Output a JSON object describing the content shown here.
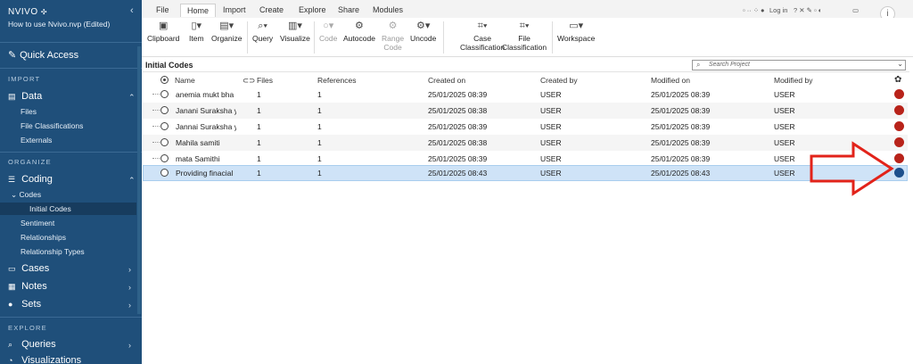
{
  "sidebar": {
    "logo": "NVIVO",
    "project_name": "How to use Nvivo.nvp (Edited)",
    "quick_access": "Quick Access",
    "import_section": "IMPORT",
    "data": "Data",
    "data_items": [
      "Files",
      "File Classifications",
      "Externals"
    ],
    "organize_section": "ORGANIZE",
    "coding": "Coding",
    "codes": "Codes",
    "initial_codes": "Initial Codes",
    "coding_items": [
      "Sentiment",
      "Relationships",
      "Relationship Types"
    ],
    "cases": "Cases",
    "notes": "Notes",
    "sets": "Sets",
    "explore_section": "EXPLORE",
    "queries": "Queries",
    "visualizations": "Visualizations"
  },
  "tabs": [
    "File",
    "Home",
    "Import",
    "Create",
    "Explore",
    "Share",
    "Modules"
  ],
  "active_tab": "Home",
  "login": "Log in",
  "ribbon": {
    "clipboard": "Clipboard",
    "item": "Item",
    "organize": "Organize",
    "query": "Query",
    "visualize": "Visualize",
    "code": "Code",
    "autocode": "Autocode",
    "range_code_1": "Range",
    "range_code_2": "Code",
    "uncode": "Uncode",
    "case_class_1": "Case",
    "case_class_2": "Classification",
    "file_class_1": "File",
    "file_class_2": "Classification",
    "workspace": "Workspace"
  },
  "panel_title": "Initial Codes",
  "search_placeholder": "Search Project",
  "columns": {
    "name": "Name",
    "files": "Files",
    "references": "References",
    "created_on": "Created on",
    "created_by": "Created by",
    "modified_on": "Modified on",
    "modified_by": "Modified by"
  },
  "rows": [
    {
      "name": "anemia mukt bha",
      "files": "1",
      "references": "1",
      "created_on": "25/01/2025 08:39",
      "created_by": "USER",
      "modified_on": "25/01/2025 08:39",
      "modified_by": "USER",
      "color": "#b8231a"
    },
    {
      "name": "Janani Suraksha y",
      "files": "1",
      "references": "1",
      "created_on": "25/01/2025 08:38",
      "created_by": "USER",
      "modified_on": "25/01/2025 08:39",
      "modified_by": "USER",
      "color": "#b8231a"
    },
    {
      "name": "Jannai Suraksha y",
      "files": "1",
      "references": "1",
      "created_on": "25/01/2025 08:39",
      "created_by": "USER",
      "modified_on": "25/01/2025 08:39",
      "modified_by": "USER",
      "color": "#b8231a"
    },
    {
      "name": "Mahila samiti",
      "files": "1",
      "references": "1",
      "created_on": "25/01/2025 08:38",
      "created_by": "USER",
      "modified_on": "25/01/2025 08:39",
      "modified_by": "USER",
      "color": "#b8231a"
    },
    {
      "name": "mata Samithi",
      "files": "1",
      "references": "1",
      "created_on": "25/01/2025 08:39",
      "created_by": "USER",
      "modified_on": "25/01/2025 08:39",
      "modified_by": "USER",
      "color": "#b8231a"
    },
    {
      "name": "Providing  finacial",
      "files": "1",
      "references": "1",
      "created_on": "25/01/2025 08:43",
      "created_by": "USER",
      "modified_on": "25/01/2025 08:43",
      "modified_by": "USER",
      "color": "#1c4f8c"
    }
  ],
  "colors": {
    "sidebar_bg": "#1f4f7a",
    "selected_row": "#cfe3f7",
    "code_red": "#b8231a",
    "code_blue": "#1c4f8c",
    "annotation_arrow": "#e2231a"
  }
}
